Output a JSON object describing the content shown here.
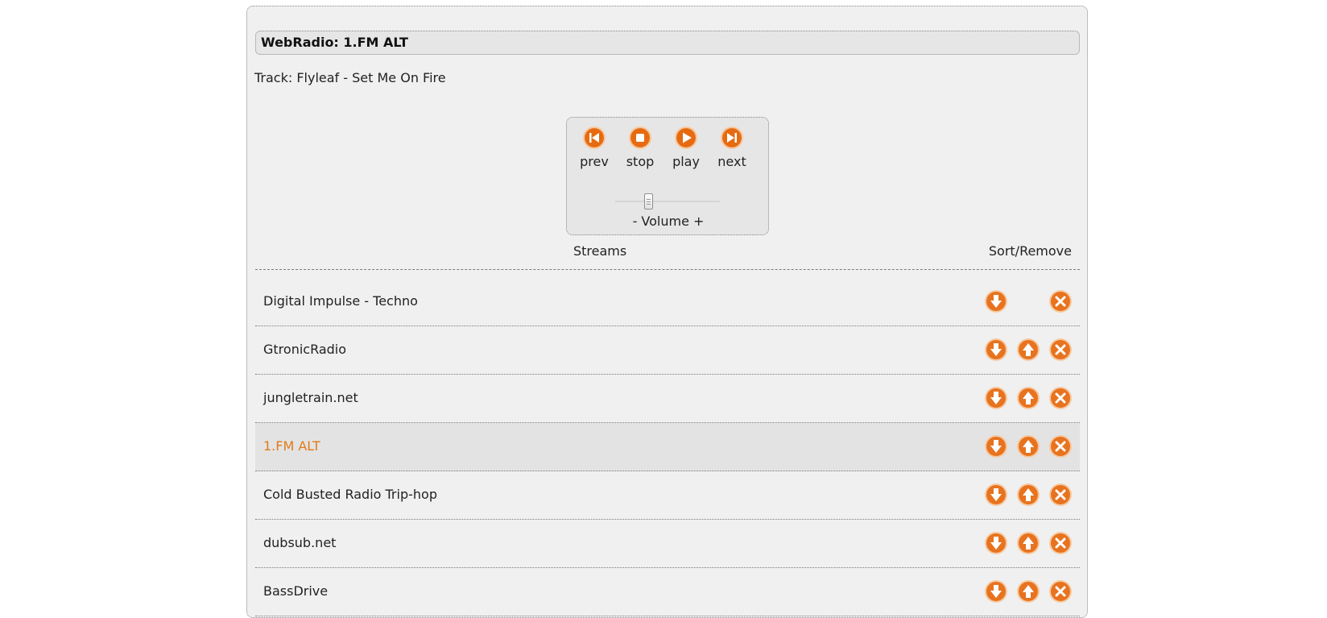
{
  "app": {
    "title": "WebRadio: 1.FM ALT",
    "track": "Track: Flyleaf - Set Me On Fire"
  },
  "controls": {
    "prev": "prev",
    "stop": "stop",
    "play": "play",
    "next": "next",
    "volume_label": "- Volume +",
    "volume_level": 0.3
  },
  "list": {
    "header_streams": "Streams",
    "header_sort": "Sort/Remove",
    "active_stream": "1.FM ALT",
    "streams": [
      {
        "name": "Digital Impulse - Techno"
      },
      {
        "name": "GtronicRadio"
      },
      {
        "name": "jungletrain.net"
      },
      {
        "name": "1.FM ALT"
      },
      {
        "name": "Cold Busted Radio Trip-hop"
      },
      {
        "name": "dubsub.net"
      },
      {
        "name": "BassDrive"
      }
    ]
  },
  "colors": {
    "accent": "#e8731f",
    "accent_dark": "#c85a10",
    "panel_bg": "#f0f0f0"
  }
}
